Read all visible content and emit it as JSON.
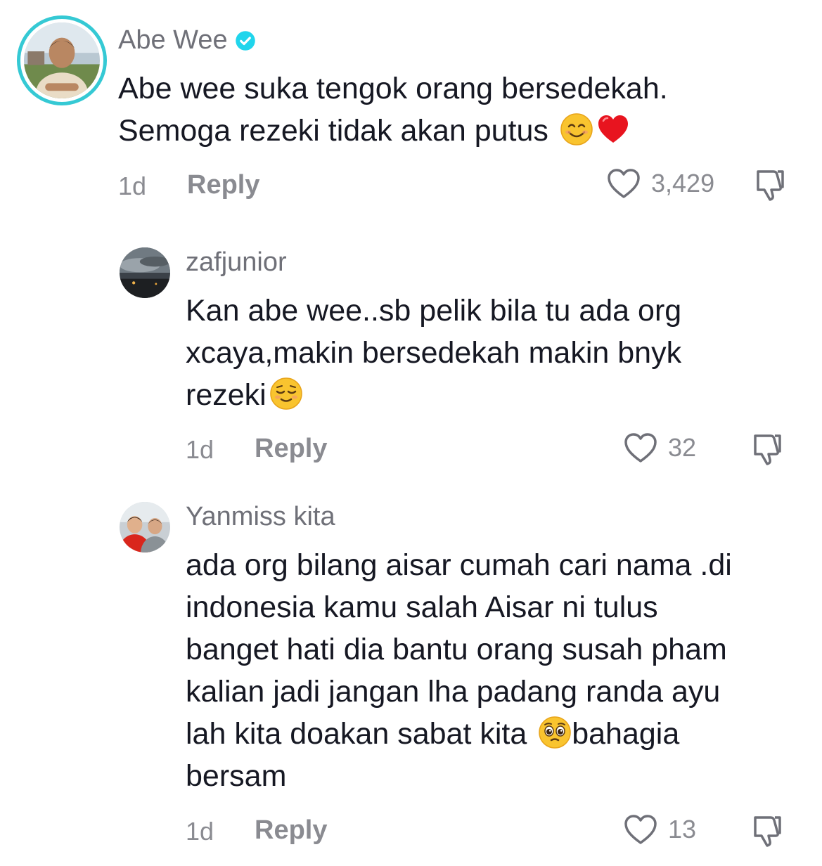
{
  "comments": [
    {
      "username": "Abe Wee",
      "verified": true,
      "text_lines": [
        "Abe wee suka tengok orang bersedekah.",
        "Semoga rezeki tidak akan putus"
      ],
      "emojis": [
        "smiling-face-icon",
        "red-heart-icon"
      ],
      "time": "1d",
      "reply_label": "Reply",
      "likes": "3,429"
    },
    {
      "username": "zafjunior",
      "verified": false,
      "text_lines": [
        "Kan abe wee..sb pelik bila tu ada org",
        "xcaya,makin bersedekah makin bnyk",
        "rezeki"
      ],
      "emojis": [
        "relieved-face-icon"
      ],
      "time": "1d",
      "reply_label": "Reply",
      "likes": "32"
    },
    {
      "username": "Yanmiss kita",
      "verified": false,
      "text_lines": [
        "ada org bilang aisar cumah cari nama .di",
        "indonesia kamu salah Aisar ni tulus",
        "banget hati dia bantu orang susah pham",
        "kalian jadi jangan lha padang randa ayu",
        "lah kita doakan sabat kita ",
        "bahagia",
        "bersam"
      ],
      "emojis": [
        "pleading-face-icon"
      ],
      "time": "1d",
      "reply_label": "Reply",
      "likes": "13"
    }
  ],
  "colors": {
    "verified": "#20d5ec",
    "ring": "#35c9d4",
    "muted": "#8a8b91",
    "text": "#161823"
  }
}
